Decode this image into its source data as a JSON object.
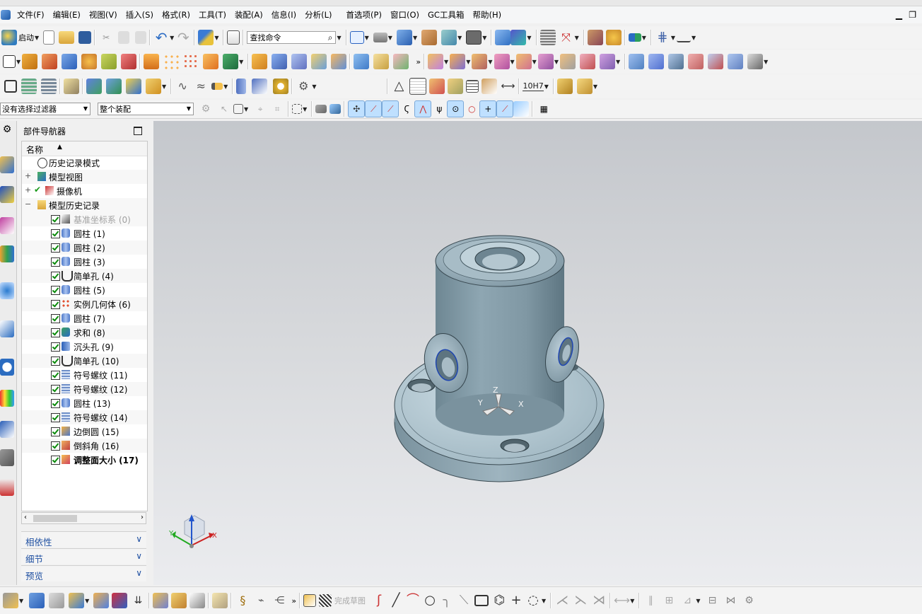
{
  "menu": [
    "文件(F)",
    "编辑(E)",
    "视图(V)",
    "插入(S)",
    "格式(R)",
    "工具(T)",
    "装配(A)",
    "信息(I)",
    "分析(L)",
    "首选项(P)",
    "窗口(O)",
    "GC工具箱",
    "帮助(H)"
  ],
  "toolbar": {
    "start_label": "启动",
    "search_placeholder": "查找命令",
    "filter_select": "没有选择过滤器",
    "scope_select": "整个装配",
    "fit_label": "10H7",
    "finish_sketch_label": "完成草图"
  },
  "navigator": {
    "title": "部件导航器",
    "column_name": "名称",
    "top_items": [
      {
        "label": "历史记录模式",
        "icon": "clock-icon"
      },
      {
        "label": "模型视图",
        "icon": "model-views-icon"
      },
      {
        "label": "摄像机",
        "icon": "camera-icon"
      },
      {
        "label": "模型历史记录",
        "icon": "folder-icon"
      }
    ],
    "features": [
      {
        "label": "基准坐标系 (0)",
        "icon": "datum-csys-icon",
        "dimmed": true
      },
      {
        "label": "圆柱 (1)",
        "icon": "cylinder-icon"
      },
      {
        "label": "圆柱 (2)",
        "icon": "cylinder-icon"
      },
      {
        "label": "圆柱 (3)",
        "icon": "cylinder-icon"
      },
      {
        "label": "简单孔 (4)",
        "icon": "simple-hole-icon"
      },
      {
        "label": "圆柱 (5)",
        "icon": "cylinder-icon"
      },
      {
        "label": "实例几何体 (6)",
        "icon": "instance-geometry-icon"
      },
      {
        "label": "圆柱 (7)",
        "icon": "cylinder-icon"
      },
      {
        "label": "求和 (8)",
        "icon": "unite-icon"
      },
      {
        "label": "沉头孔 (9)",
        "icon": "counterbore-hole-icon"
      },
      {
        "label": "简单孔 (10)",
        "icon": "simple-hole-icon"
      },
      {
        "label": "符号螺纹 (11)",
        "icon": "thread-icon"
      },
      {
        "label": "符号螺纹 (12)",
        "icon": "thread-icon"
      },
      {
        "label": "圆柱 (13)",
        "icon": "cylinder-icon"
      },
      {
        "label": "符号螺纹 (14)",
        "icon": "thread-icon"
      },
      {
        "label": "边倒圆 (15)",
        "icon": "edge-blend-icon"
      },
      {
        "label": "倒斜角 (16)",
        "icon": "chamfer-icon"
      },
      {
        "label": "调整面大小 (17)",
        "icon": "resize-face-icon",
        "bold": true
      }
    ],
    "panels": [
      "相依性",
      "细节",
      "预览"
    ]
  },
  "viewport": {
    "axis_labels": {
      "x": "X",
      "y": "Y",
      "z": "Z"
    }
  },
  "colors": {
    "accent": "#1e4fa1",
    "viewport_top": "#c4c7cc",
    "viewport_bottom": "#ebecef",
    "part": "#8fa7b3"
  }
}
